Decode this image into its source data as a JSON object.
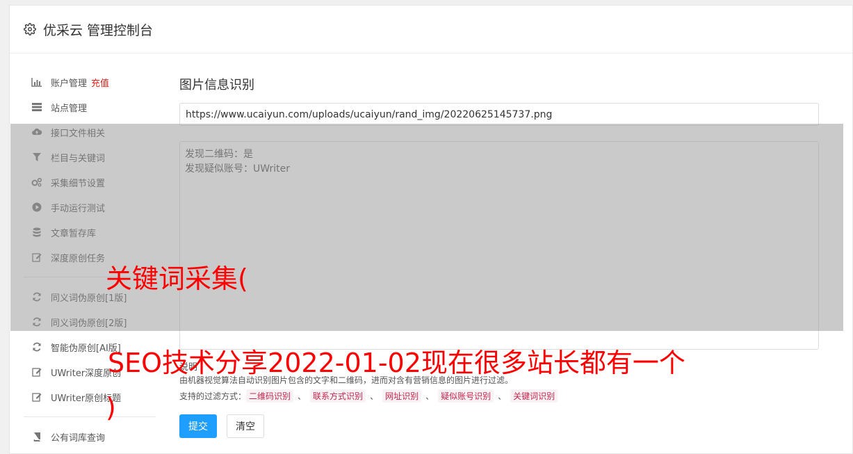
{
  "header": {
    "title": "优采云 管理控制台",
    "icon": "gear-icon"
  },
  "sidebar": {
    "groups": [
      [
        {
          "label": "账户管理",
          "badge": "充值",
          "icon": "bar-chart-icon"
        },
        {
          "label": "站点管理",
          "icon": "server-icon"
        },
        {
          "label": "接口文件相关",
          "icon": "cloud-upload-icon"
        },
        {
          "label": "栏目与关键词",
          "icon": "filter-icon"
        },
        {
          "label": "采集细节设置",
          "icon": "gears-icon"
        },
        {
          "label": "手动运行测试",
          "icon": "play-icon"
        },
        {
          "label": "文章暂存库",
          "icon": "database-icon"
        },
        {
          "label": "深度原创任务",
          "icon": "edit-icon"
        }
      ],
      [
        {
          "label": "同义词伪原创[1版]",
          "icon": "refresh-icon"
        },
        {
          "label": "同义词伪原创[2版]",
          "icon": "refresh-icon"
        },
        {
          "label": "智能伪原创[AI版]",
          "icon": "refresh-icon"
        },
        {
          "label": "UWriter深度原创",
          "icon": "edit-icon"
        },
        {
          "label": "UWriter原创标题",
          "icon": "edit-icon"
        }
      ],
      [
        {
          "label": "公有词库查询",
          "icon": "book-icon"
        }
      ]
    ]
  },
  "main": {
    "title": "图片信息识别",
    "url_value": "https://www.ucaiyun.com/uploads/ucaiyun/rand_img/20220625145737.png",
    "result_lines": [
      "发现二维码：是",
      "发现疑似账号：UWriter"
    ],
    "desc_label": "说明",
    "desc_text": "由机器视觉算法自动识别图片包含的文字和二维码，进而对含有营销信息的图片进行过滤。",
    "filters_label": "支持的过滤方式：",
    "filters": [
      "二维码识别",
      "联系方式识别",
      "网址识别",
      "疑似账号识别",
      "关键词识别"
    ],
    "filter_separator": "、",
    "submit_label": "提交",
    "clear_label": "清空"
  },
  "overlay": {
    "line1": "关键词采集(",
    "line2": "SEO技术分享2022-01-02现在很多站长都有一个",
    "line3": ")"
  },
  "colors": {
    "primary": "#1e9fff",
    "badge": "#e0201b",
    "filter_tag": "#c7254e",
    "overlay_text": "#ff0000"
  }
}
